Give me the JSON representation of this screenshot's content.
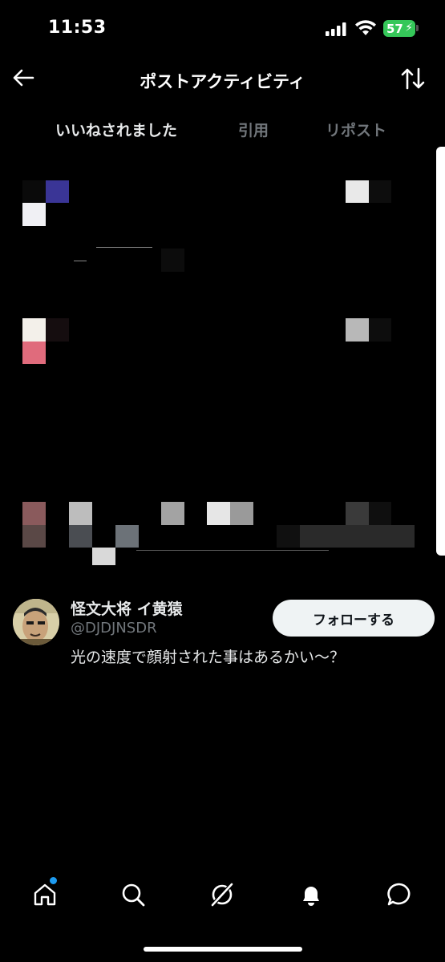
{
  "status_bar": {
    "time": "11:53",
    "battery_level": "57",
    "battery_color": "#35c759",
    "icons": [
      "signal-icon",
      "wifi-icon",
      "battery-icon"
    ]
  },
  "header": {
    "title": "ポストアクティビティ",
    "back_icon": "arrow-left-icon",
    "sort_icon": "sort-arrows-icon"
  },
  "tabs": [
    {
      "label": "いいねされました",
      "active": true
    },
    {
      "label": "引用",
      "active": false
    },
    {
      "label": "リポスト",
      "active": false
    }
  ],
  "user": {
    "display_name": "怪文大将 イ黄猿",
    "handle": "@DJDJNSDR",
    "bio": "光の速度で顔射された事はあるかい〜？",
    "follow_label": "フォローする"
  },
  "bottom_nav": {
    "items": [
      "home-icon",
      "search-icon",
      "grok-icon",
      "notifications-icon",
      "messages-icon"
    ],
    "home_badge_color": "#1d9bf0"
  },
  "colors": {
    "background": "#000000",
    "text_primary": "#e7e9ea",
    "text_secondary": "#71767b",
    "accent": "#1d9bf0",
    "follow_button_bg": "#eff3f4"
  }
}
